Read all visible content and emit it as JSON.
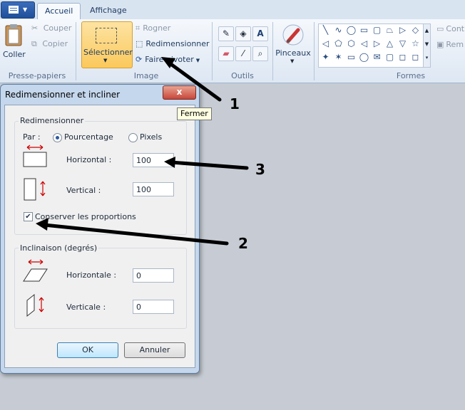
{
  "ribbon": {
    "tabs": [
      "Accueil",
      "Affichage"
    ],
    "clipboard": {
      "paste": "Coller",
      "cut": "Couper",
      "copy": "Copier",
      "group": "Presse-papiers"
    },
    "image": {
      "select": "Sélectionner",
      "crop": "Rogner",
      "resize": "Redimensionner",
      "rotate": "Faire pivoter",
      "group": "Image"
    },
    "tools": {
      "group": "Outils"
    },
    "brushes": {
      "label": "Pinceaux"
    },
    "shapes": {
      "group": "Formes",
      "contour": "Cont",
      "fill": "Rem"
    }
  },
  "dialog": {
    "title": "Redimensionner et incliner",
    "close_glyph": "x",
    "tooltip": "Fermer",
    "resize": {
      "legend": "Redimensionner",
      "by_label": "Par :",
      "percent_label": "Pourcentage",
      "pixels_label": "Pixels",
      "horizontal_label": "Horizontal :",
      "horizontal_value": "100",
      "vertical_label": "Vertical :",
      "vertical_value": "100",
      "keep_ratio_label": "Conserver les proportions",
      "keep_ratio_checked": true
    },
    "skew": {
      "legend": "Inclinaison (degrés)",
      "horizontal_label": "Horizontale :",
      "horizontal_value": "0",
      "vertical_label": "Verticale :",
      "vertical_value": "0"
    },
    "ok": "OK",
    "cancel": "Annuler"
  },
  "annotations": [
    "1",
    "2",
    "3"
  ],
  "colors": {
    "accent": "#2c5a9e",
    "select_highlight": "#fbc95c",
    "close_red": "#c7463a",
    "arrow": "#000000",
    "stretch_arrow": "#cc0000"
  }
}
